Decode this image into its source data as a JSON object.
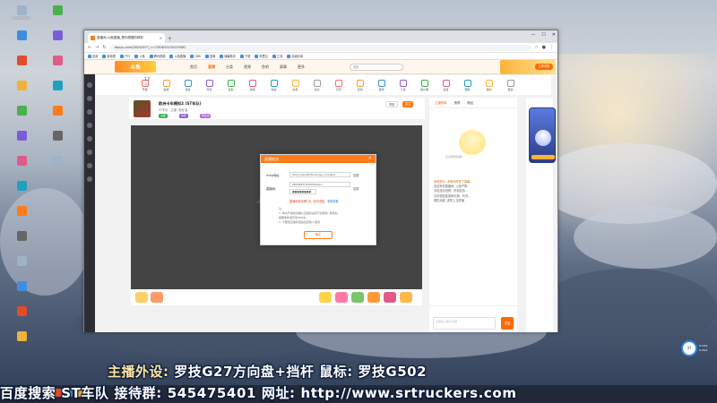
{
  "desktop": {
    "icons": [
      "Recycle Bin",
      "",
      "",
      "",
      "",
      "",
      "",
      "",
      "",
      "",
      "",
      "",
      "",
      "",
      "",
      "",
      "",
      "",
      "",
      "",
      ""
    ]
  },
  "browser": {
    "tab_title": "直播间-斗鱼直播_是你想要的精彩",
    "url": "douyu.com/2825287?_r=1780832430239082",
    "bookmarks": [
      "应用",
      "新电视",
      "户口",
      "斗鱼",
      "腾讯视频",
      "斗鱼直播",
      "OBS",
      "蓝海",
      "弹幕助手",
      "下载",
      "阿里云",
      "工具",
      "阅读清单"
    ],
    "window_controls": [
      "—",
      "☐",
      "✕"
    ]
  },
  "site": {
    "logo": "斗鱼",
    "nav": [
      "首页",
      "直播",
      "分类",
      "视频",
      "鱼吧",
      "赛事",
      "更多"
    ],
    "nav_active": "直播",
    "search_placeholder": "搜索",
    "banner_button": "立即领取",
    "category_count": "12",
    "category_count_label": "关注",
    "categories": [
      "开播",
      "鱼塘",
      "消息",
      "历史",
      "任务",
      "商城",
      "动态",
      "充值",
      "关注",
      "订阅",
      "活动",
      "游戏",
      "下载",
      "客户端",
      "设置",
      "帮助",
      "我的",
      "更多"
    ]
  },
  "room": {
    "title": "欧洲卡车模拟2 (ST车队)",
    "subtitle": "ST车队 · 主播: 洛洛·星",
    "tags": [
      "主播",
      "等级",
      "粉丝团"
    ],
    "report_label": "举报",
    "follow_label": "关注"
  },
  "right_panel": {
    "tabs": [
      "主播榜单",
      "贵宾",
      "粉丝"
    ],
    "mascot_text": "还没有粉丝哦~",
    "chat_lines": [
      "系统提示: 本房间开放了弹幕...",
      "欢迎来到直播间, 斗鱼严禁...",
      "涉及违法违规、低俗色情...",
      "请勿相信各类刷礼物、代充...",
      "理性消费, 谨防上当受骗"
    ],
    "input_placeholder": "这里输入聊天内容",
    "send_label": "发送"
  },
  "modal": {
    "title": "直播推流",
    "rtmp_label": "rtmp地址:",
    "rtmp_value": "rtmp://sendtc3a.douyu.com/live",
    "key_label": "直播码:",
    "key_value": "2825287r2O2hF5wUn...",
    "key_masked": "●●●●●●●●",
    "copy_label": "复制",
    "warning": "直播码有效期7天, 请勿泄露",
    "refresh_label": "重新获取",
    "notes": [
      "注:",
      "1. 每次开播前请确认直播码是否已经刷新, 刷新后",
      "需要重新填写到OBS中。",
      "2. 不要把直播码泄露给其他人使用"
    ],
    "confirm_label": "确定"
  },
  "overlay": {
    "line1_a": "主播外设:",
    "line1_b": "罗技G27方向盘+挡杆  鼠标: 罗技G502",
    "line2": "百度搜索   ST车队 接待群: 545475401   网址: http://www.srtruckers.com"
  },
  "speed_widget": {
    "value": "37",
    "lines": [
      "0.1K/s",
      "0.2K/s"
    ]
  },
  "colors": {
    "brand": "#ff7a1a",
    "player_bg": "#444444"
  }
}
